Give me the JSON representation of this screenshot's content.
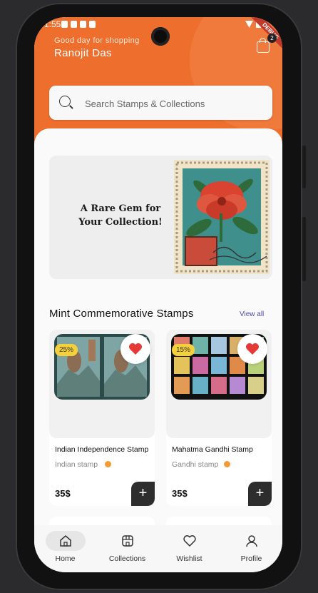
{
  "status_bar": {
    "time": "1:55"
  },
  "debug_banner": "DEBUG",
  "header": {
    "greeting": "Good day for shopping",
    "user_name": "Ranojit Das",
    "cart_count": "2",
    "icons": {
      "cart": "shopping-bag-icon"
    }
  },
  "search": {
    "placeholder": "Search Stamps & Collections",
    "value": ""
  },
  "banner": {
    "line1": "A Rare Gem for",
    "line2": "Your Collection!"
  },
  "section": {
    "title": "Mint Commemorative Stamps",
    "view_all": "View all"
  },
  "products": [
    {
      "name": "Indian Independence Stamp",
      "category": "Indian stamp",
      "price": "35$",
      "discount": "25%",
      "favorited": true
    },
    {
      "name": "Mahatma Gandhi Stamp",
      "category": "Gandhi stamp",
      "price": "35$",
      "discount": "15%",
      "favorited": true
    }
  ],
  "nav": [
    {
      "label": "Home",
      "icon": "home-icon",
      "active": true
    },
    {
      "label": "Collections",
      "icon": "store-icon",
      "active": false
    },
    {
      "label": "Wishlist",
      "icon": "heart-icon",
      "active": false
    },
    {
      "label": "Profile",
      "icon": "person-icon",
      "active": false
    }
  ],
  "colors": {
    "primary": "#ee6f2d",
    "accent": "#4b4aa6",
    "badge": "#f4d13b",
    "heart": "#e53935",
    "dark": "#2d2d2d"
  }
}
